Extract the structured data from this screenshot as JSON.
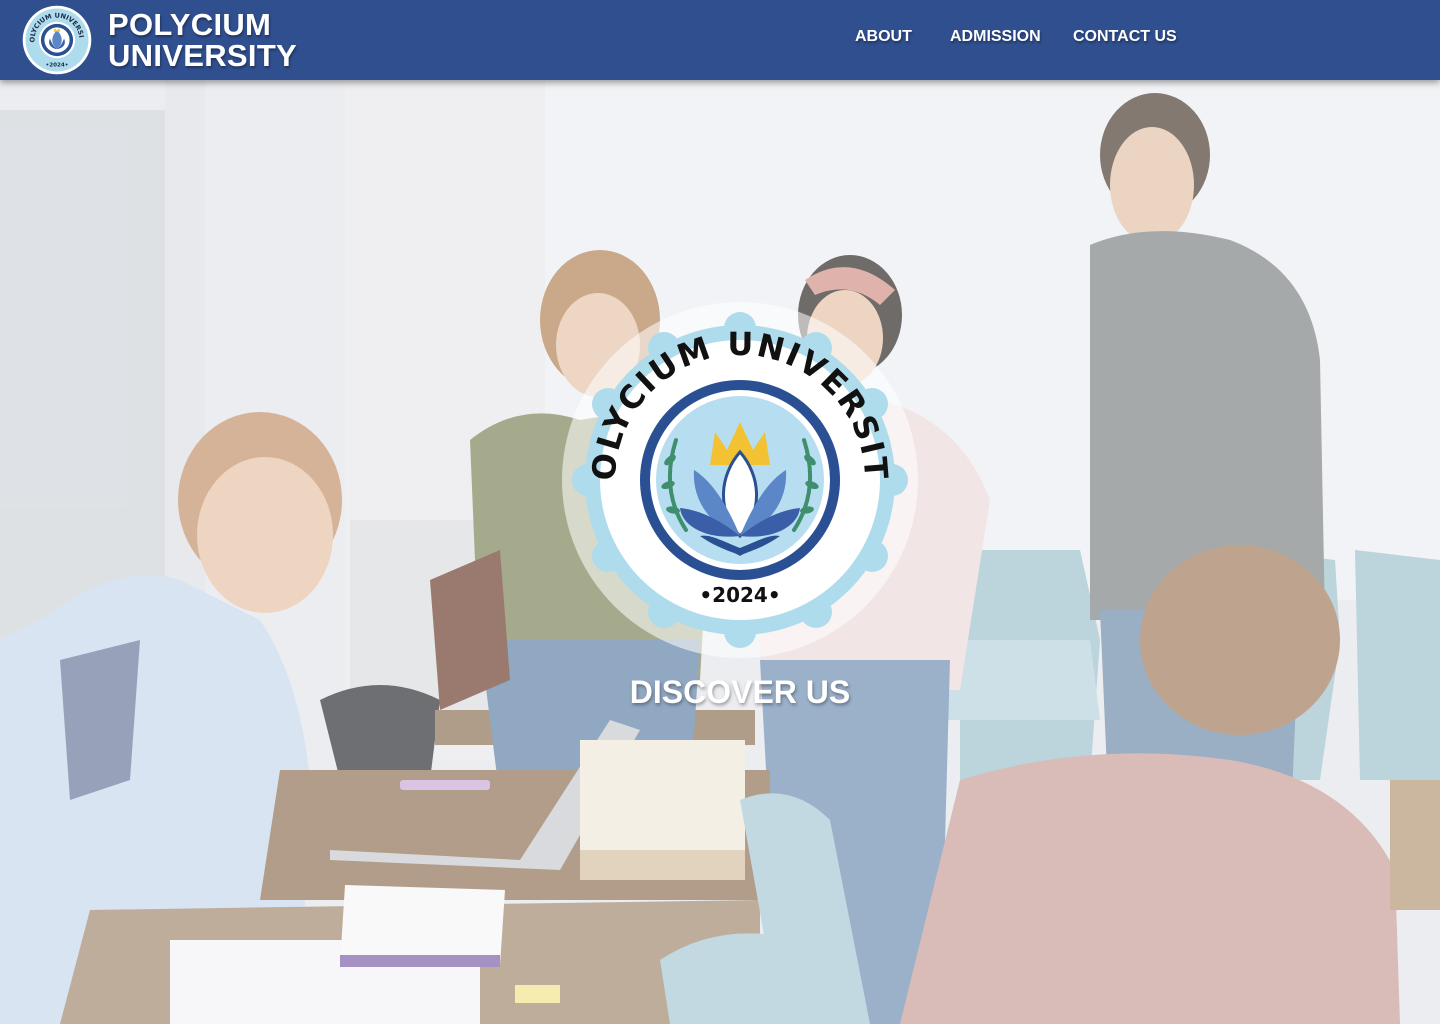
{
  "header": {
    "brand_line1": "POLYCIUM",
    "brand_line2": "UNIVERSITY",
    "nav": [
      {
        "label": "ABOUT"
      },
      {
        "label": "ADMISSION"
      },
      {
        "label": "CONTACT US"
      }
    ]
  },
  "logo": {
    "ring_text": "POLYCIUM UNIVERSITY",
    "year": "•2024•",
    "icon": "lotus-crown-seal"
  },
  "hero": {
    "cta": "DISCOVER US",
    "photo": "students-in-classroom"
  },
  "colors": {
    "header_bg": "#304f8f",
    "seal_outer": "#aedcec",
    "seal_ring": "#2a4f93",
    "seal_lotus": "#5b86c8",
    "seal_crown": "#f2c232",
    "text": "#ffffff"
  }
}
